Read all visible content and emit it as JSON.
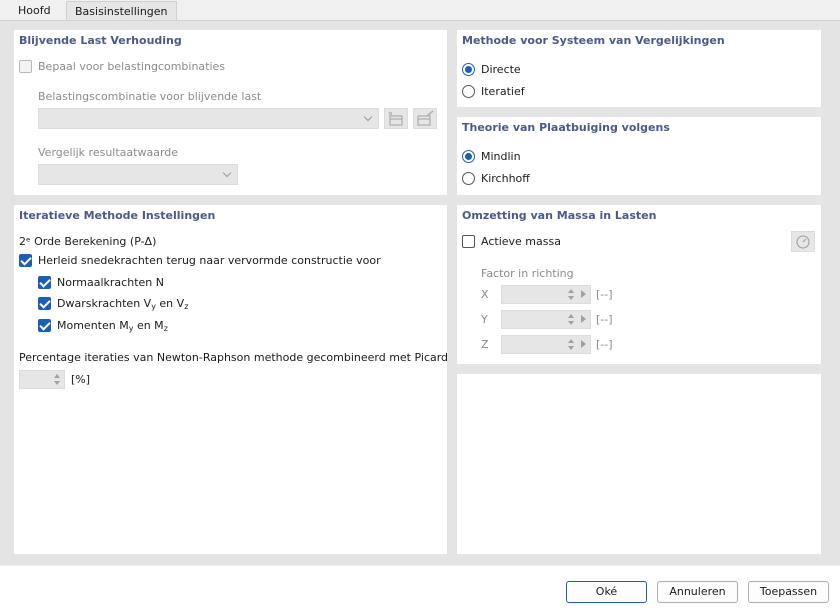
{
  "tabs": [
    {
      "label": "Hoofd",
      "active": false
    },
    {
      "label": "Basisinstellingen",
      "active": true
    }
  ],
  "blijvende": {
    "title": "Blijvende Last Verhouding",
    "bepaal_label": "Bepaal voor belastingcombinaties",
    "bepaal_checked": false,
    "combi_label": "Belastingscombinatie voor blijvende last",
    "combi_value": "",
    "vergelijk_label": "Vergelijk resultaatwaarde",
    "vergelijk_value": ""
  },
  "methode": {
    "title": "Methode voor Systeem van Vergelijkingen",
    "options": [
      {
        "label": "Directe",
        "selected": true
      },
      {
        "label": "Iteratief",
        "selected": false
      }
    ]
  },
  "theorie": {
    "title": "Theorie van Plaatbuiging volgens",
    "options": [
      {
        "label": "Mindlin",
        "selected": true
      },
      {
        "label": "Kirchhoff",
        "selected": false
      }
    ]
  },
  "iteratief": {
    "title": "Iteratieve Methode Instellingen",
    "orde_label": "2ᵉ Orde Berekening (P-Δ)",
    "herleid_label": "Herleid snedekrachten terug naar vervormde constructie voor",
    "normaal_label": "Normaalkrachten N",
    "dwars_prefix": "Dwarskrachten V",
    "dwars_sub1": "y",
    "dwars_mid": " en V",
    "dwars_sub2": "z",
    "momenten_prefix": "Momenten M",
    "momenten_sub1": "y",
    "momenten_mid": " en M",
    "momenten_sub2": "z",
    "percentage_label": "Percentage iteraties van Newton-Raphson methode gecombineerd met Picard",
    "percentage_value": "",
    "percentage_unit": "[%]"
  },
  "massa": {
    "title": "Omzetting van Massa in Lasten",
    "actieve_label": "Actieve massa",
    "actieve_checked": false,
    "factor_label": "Factor in richting",
    "rows": [
      {
        "axis": "X",
        "value": "",
        "unit": "[--]"
      },
      {
        "axis": "Y",
        "value": "",
        "unit": "[--]"
      },
      {
        "axis": "Z",
        "value": "",
        "unit": "[--]"
      }
    ]
  },
  "footer": {
    "ok_label": "Oké",
    "cancel_label": "Annuleren",
    "apply_label": "Toepassen"
  },
  "colors": {
    "accent": "#1a5fb4",
    "title": "#4a5a86",
    "panel_bg": "#ffffff",
    "window_bg": "#e4e4e4"
  }
}
